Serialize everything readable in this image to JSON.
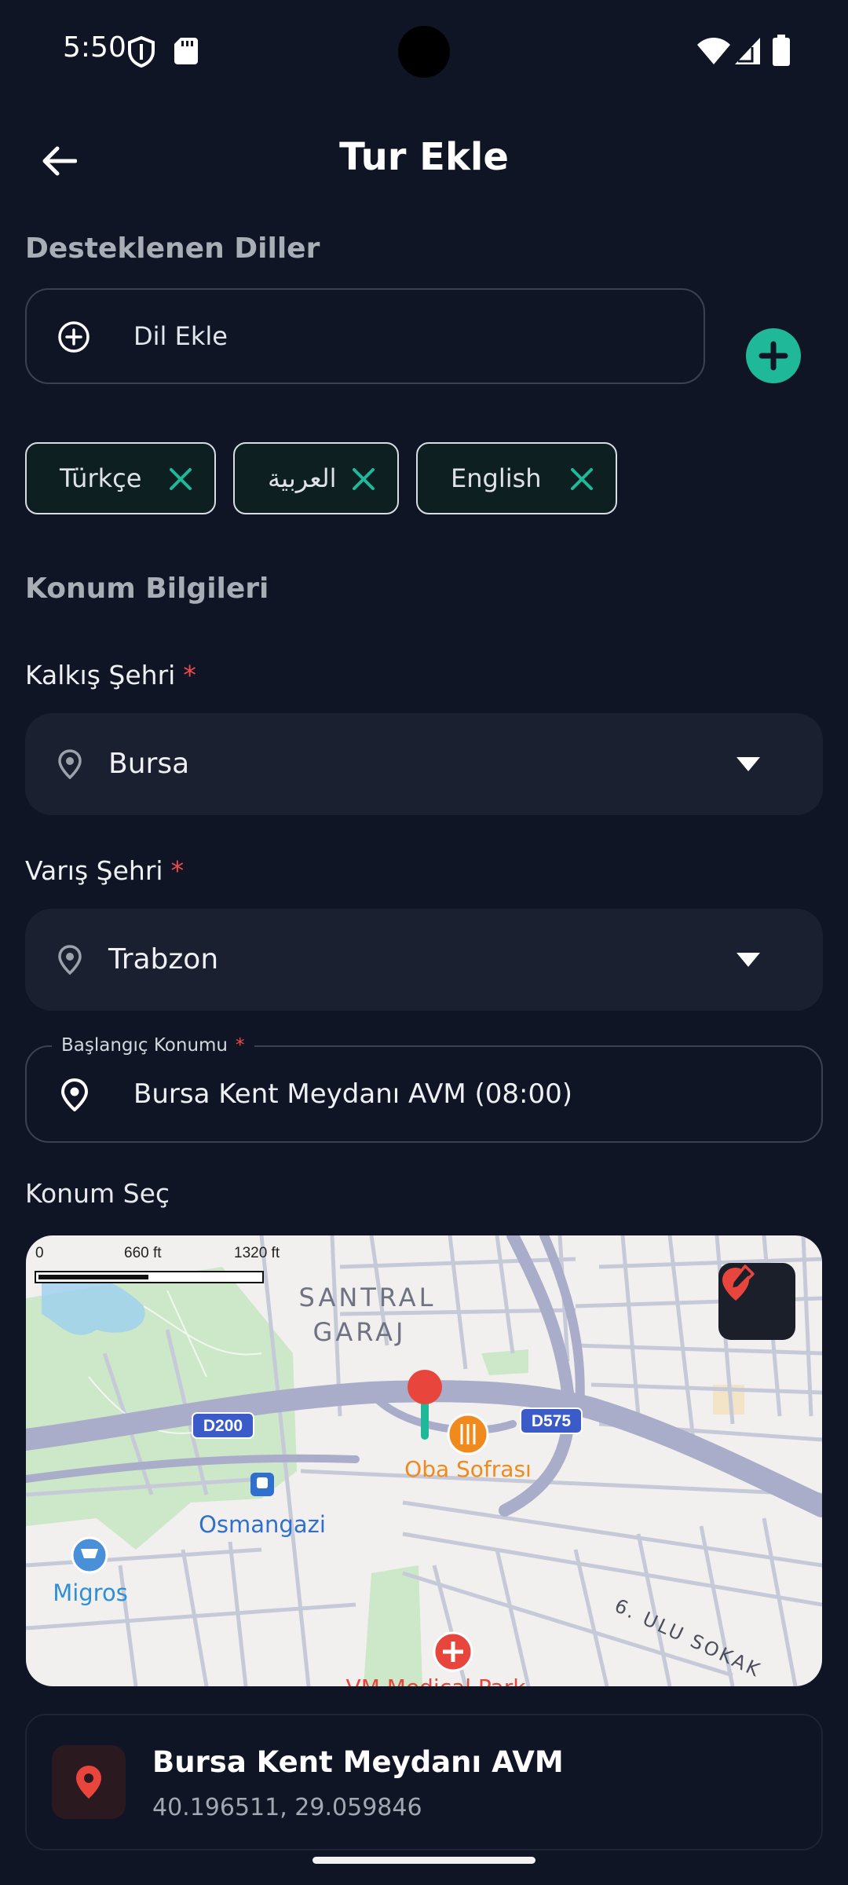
{
  "status_bar": {
    "time": "5:50"
  },
  "header": {
    "title": "Tur Ekle"
  },
  "languages": {
    "section_title": "Desteklenen Diller",
    "input_placeholder": "Dil Ekle",
    "chips": [
      "Türkçe",
      "العربية",
      "English"
    ]
  },
  "location": {
    "section_title": "Konum Bilgileri",
    "departure_label": "Kalkış Şehri",
    "departure_value": "Bursa",
    "arrival_label": "Varış Şehri",
    "arrival_value": "Trabzon",
    "required_marker": "*",
    "start_label": "Başlangıç Konumu",
    "start_value": "Bursa Kent Meydanı AVM (08:00)",
    "pick_label": "Konum Seç"
  },
  "map": {
    "scale_labels": [
      "0",
      "660 ft",
      "1320 ft"
    ],
    "labels": {
      "santral": "SANTRAL",
      "garaj": "GARAJ",
      "road_d200": "D200",
      "road_d575": "D575",
      "restaurant": "Oba Sofrası",
      "district": "Osmangazi",
      "store": "Migros",
      "street": "6. ULU SOKAK",
      "hospital": "VM Medical Park"
    },
    "colors": {
      "marker": "#e8453c",
      "restaurant": "#f08a1c",
      "label_blue": "#2f6fd0"
    }
  },
  "selected_location": {
    "name": "Bursa Kent Meydanı AVM",
    "coords": "40.196511, 29.059846"
  },
  "colors": {
    "accent": "#1fb99a",
    "background": "#0f1524",
    "required": "#ef4b4b"
  }
}
